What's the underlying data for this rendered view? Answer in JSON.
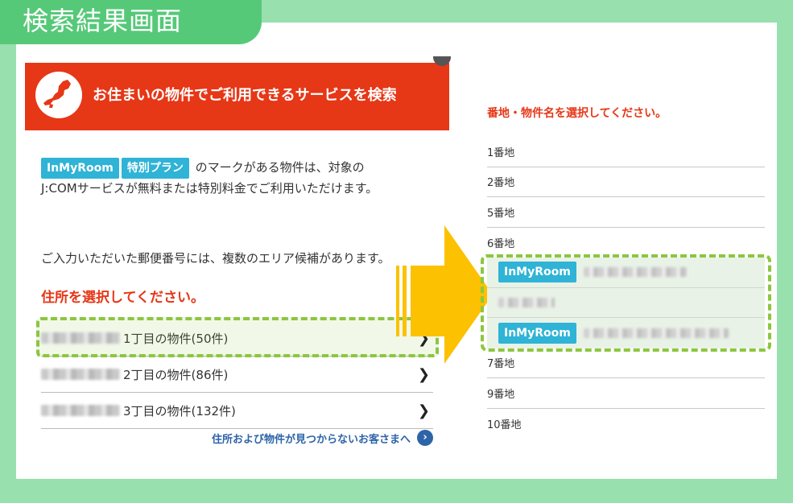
{
  "page_title": "検索結果画面",
  "left": {
    "header_title": "お住まいの物件でご利用できるサービスを検索",
    "badges": [
      "InMyRoom",
      "特別プラン"
    ],
    "intro_text_1": "のマークがある物件は、対象の",
    "intro_text_2": "J:COMサービスが無料または特別料金でご利用いただけます。",
    "notice": "ご入力いただいた郵便番号には、複数のエリア候補があります。",
    "select_heading": "住所を選択してください。",
    "addresses": [
      {
        "label": "1丁目の物件(50件)"
      },
      {
        "label": "2丁目の物件(86件)"
      },
      {
        "label": "3丁目の物件(132件)"
      }
    ],
    "not_found_link": "住所および物件が見つからないお客さまへ"
  },
  "right": {
    "heading": "番地・物件名を選択してください。",
    "lots_top": [
      "1番地",
      "2番地",
      "5番地",
      "6番地"
    ],
    "highlight_badge": "InMyRoom",
    "lots_bottom": [
      "7番地",
      "9番地",
      "10番地"
    ]
  },
  "colors": {
    "background": "#98e0ad",
    "tab": "#56c979",
    "header_red": "#e63717",
    "badge_blue": "#2fb3d6",
    "highlight_dash": "#8cc63f",
    "arrow": "#fcc100",
    "link_blue": "#2d64a8"
  },
  "icons": [
    "japan-map-icon",
    "chevron-right-icon",
    "circle-arrow-icon"
  ]
}
